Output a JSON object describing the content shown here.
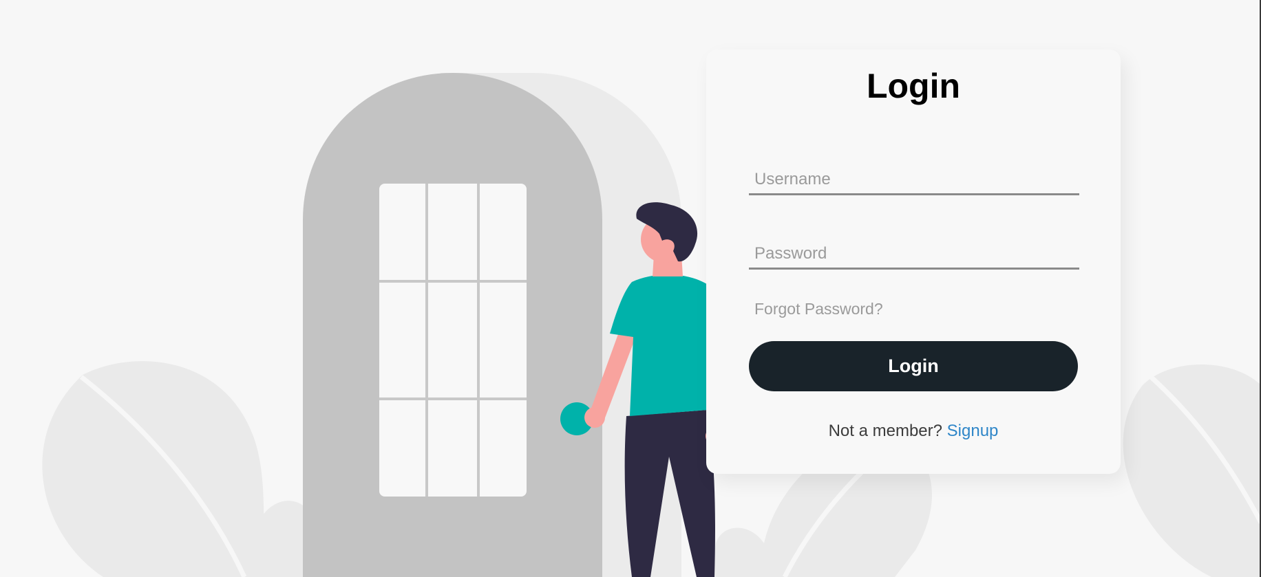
{
  "login_card": {
    "title": "Login",
    "username_placeholder": "Username",
    "password_placeholder": "Password",
    "forgot_password": "Forgot Password?",
    "login_button": "Login",
    "signup_prompt": "Not a member?",
    "signup_link": "Signup"
  },
  "colors": {
    "background": "#f7f7f7",
    "button": "#19232a",
    "link": "#2f86c8",
    "shirt": "#00b2aa",
    "skin": "#f8a39e",
    "hair_and_pants": "#2e2a43",
    "door": "#c3c3c3"
  },
  "illustration": {
    "icons": [
      "door-illustration",
      "person-illustration",
      "plant-leaf-illustration"
    ]
  }
}
